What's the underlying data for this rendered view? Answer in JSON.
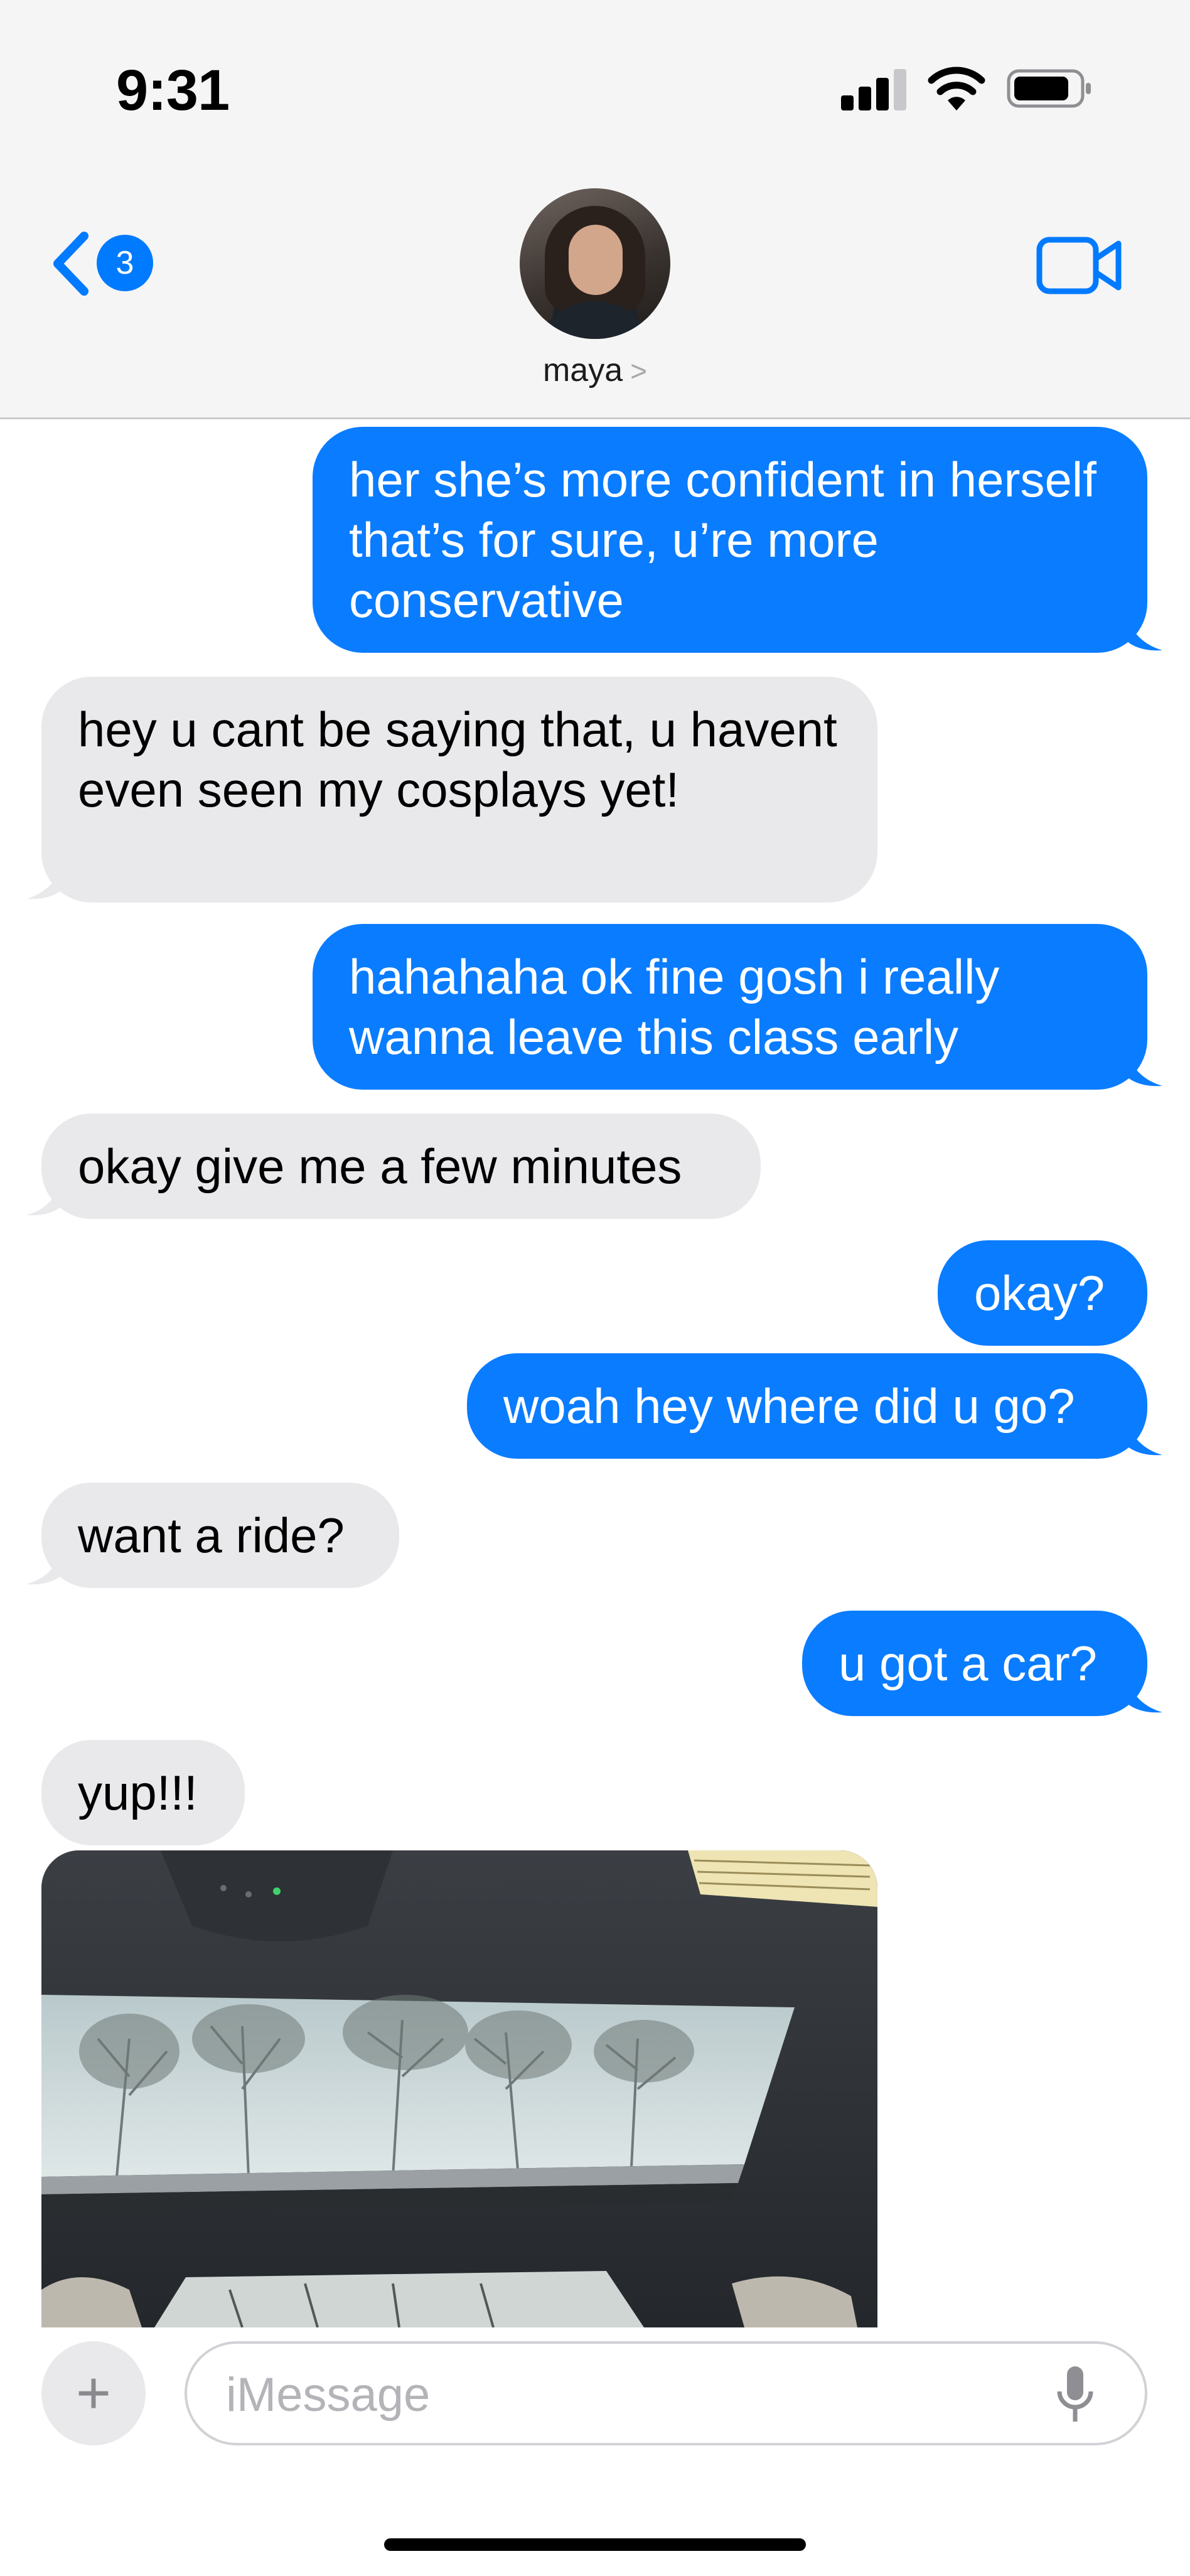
{
  "status_bar": {
    "time": "9:31"
  },
  "header": {
    "back_badge": "3",
    "contact_name": "maya",
    "name_chevron": ">"
  },
  "messages": [
    {
      "direction": "outgoing",
      "text": "her she’s more confident in herself that’s for sure, u’re more conservative"
    },
    {
      "direction": "incoming",
      "text": "hey u cant be saying that, u havent even seen my cosplays yet!"
    },
    {
      "direction": "outgoing",
      "text": "hahahaha ok fine gosh i really wanna leave this class early"
    },
    {
      "direction": "incoming",
      "text": "okay give me a few minutes"
    },
    {
      "direction": "outgoing",
      "text": "okay?"
    },
    {
      "direction": "outgoing",
      "text": "woah hey where did u go?"
    },
    {
      "direction": "incoming",
      "text": "want a ride?"
    },
    {
      "direction": "outgoing",
      "text": "u got a car?"
    },
    {
      "direction": "incoming",
      "text": "yup!!!"
    },
    {
      "direction": "incoming",
      "type": "photo",
      "subject": "car-sunroof-photo"
    }
  ],
  "input": {
    "placeholder": "iMessage",
    "plus_label": "+"
  },
  "colors": {
    "outgoing_bubble": "#0a7cff",
    "incoming_bubble": "#e9e9eb",
    "accent": "#007aff"
  },
  "icons": [
    "signal-icon",
    "wifi-icon",
    "battery-icon",
    "back-chevron-icon",
    "video-call-icon",
    "plus-icon",
    "microphone-icon"
  ]
}
